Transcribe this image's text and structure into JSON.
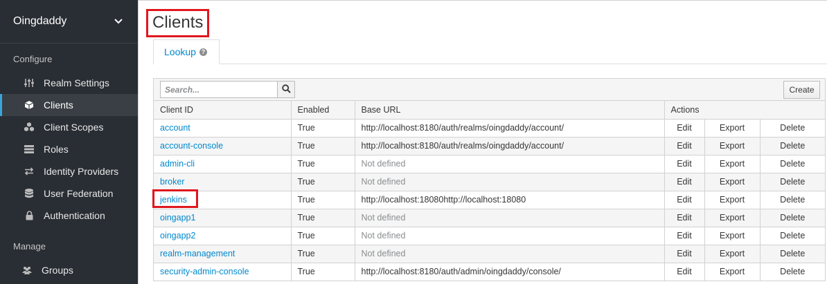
{
  "sidebar": {
    "realm": "Oingdaddy",
    "configure_label": "Configure",
    "manage_label": "Manage",
    "items": [
      {
        "label": "Realm Settings"
      },
      {
        "label": "Clients"
      },
      {
        "label": "Client Scopes"
      },
      {
        "label": "Roles"
      },
      {
        "label": "Identity Providers"
      },
      {
        "label": "User Federation"
      },
      {
        "label": "Authentication"
      }
    ],
    "manage_items": [
      {
        "label": "Groups"
      }
    ]
  },
  "page": {
    "title": "Clients",
    "tab_label": "Lookup"
  },
  "toolbar": {
    "search_placeholder": "Search...",
    "create_label": "Create"
  },
  "table": {
    "headers": [
      "Client ID",
      "Enabled",
      "Base URL",
      "Actions"
    ],
    "action_labels": [
      "Edit",
      "Export",
      "Delete"
    ],
    "rows": [
      {
        "client_id": "account",
        "enabled": "True",
        "base_url": "http://localhost:8180/auth/realms/oingdaddy/account/"
      },
      {
        "client_id": "account-console",
        "enabled": "True",
        "base_url": "http://localhost:8180/auth/realms/oingdaddy/account/"
      },
      {
        "client_id": "admin-cli",
        "enabled": "True",
        "base_url": "Not defined"
      },
      {
        "client_id": "broker",
        "enabled": "True",
        "base_url": "Not defined"
      },
      {
        "client_id": "jenkins",
        "enabled": "True",
        "base_url": "http://localhost:18080http://localhost:18080"
      },
      {
        "client_id": "oingapp1",
        "enabled": "True",
        "base_url": "Not defined"
      },
      {
        "client_id": "oingapp2",
        "enabled": "True",
        "base_url": "Not defined"
      },
      {
        "client_id": "realm-management",
        "enabled": "True",
        "base_url": "Not defined"
      },
      {
        "client_id": "security-admin-console",
        "enabled": "True",
        "base_url": "http://localhost:8180/auth/admin/oingdaddy/console/"
      }
    ]
  },
  "colors": {
    "accent": "#0088ce",
    "sidebar_bg": "#292e34",
    "highlight": "#e0161e"
  }
}
